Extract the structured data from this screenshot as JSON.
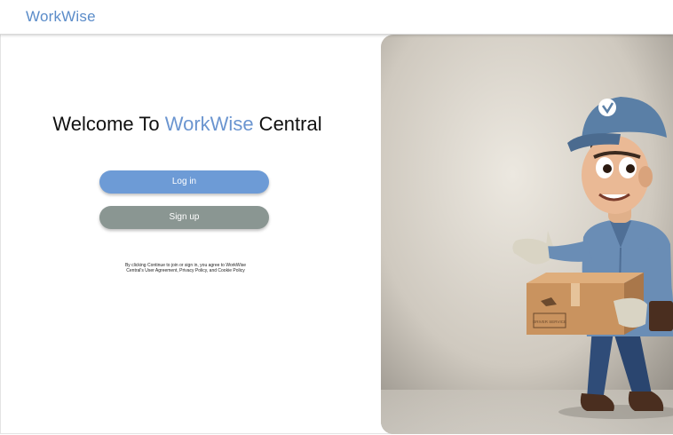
{
  "header": {
    "brand": "WorkWise"
  },
  "welcome": {
    "prefix": "Welcome To ",
    "accent": "WorkWise",
    "suffix": " Central"
  },
  "buttons": {
    "login": "Log in",
    "signup": "Sign up"
  },
  "legal": {
    "line1": "By clicking Continue to join or sign in, you agree to WorkWise",
    "line2": "Central's User Agreement, Privacy Policy, and Cookie Policy"
  },
  "colors": {
    "brand": "#5b8cc9",
    "login": "#6d9bd6",
    "signup": "#8a9692"
  },
  "hero": {
    "box_label": "DRIVER SERVICE"
  }
}
